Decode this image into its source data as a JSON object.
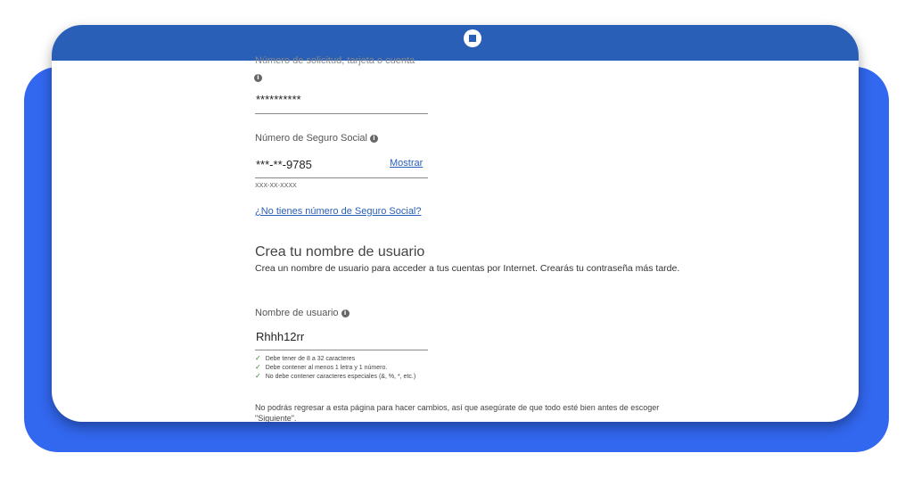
{
  "form": {
    "account_label": "Número de solicitud, tarjeta o cuenta",
    "account_value": "**********",
    "ssn_label": "Número de Seguro Social",
    "ssn_value": "***-**-9785",
    "ssn_show_link": "Mostrar",
    "ssn_format_hint": "XXX-XX-XXXX",
    "no_ssn_link": "¿No tienes número de Seguro Social?"
  },
  "username_section": {
    "heading": "Crea tu nombre de usuario",
    "description": "Crea un nombre de usuario para acceder a tus cuentas por Internet. Crearás tu contraseña más tarde.",
    "username_label": "Nombre de usuario",
    "username_value": "Rhhh12rr",
    "requirements": [
      "Debe tener de 8 a 32 caracteres",
      "Debe contener al menos 1 letra y 1 número.",
      "No debe contener caracteres especiales (&, %, *, etc.)"
    ]
  },
  "footer_note": "No podrás regresar a esta página para hacer cambios, así que asegúrate de que todo esté bien antes de escoger \"Siguiente\".",
  "colors": {
    "backdrop": "#3267ef",
    "header_bar": "#2a5fb7",
    "link": "#2a5fb7",
    "check": "#2f8a2f"
  },
  "icons": {
    "logo": "chase-octagon-logo",
    "info": "info-icon",
    "check": "check-icon"
  }
}
